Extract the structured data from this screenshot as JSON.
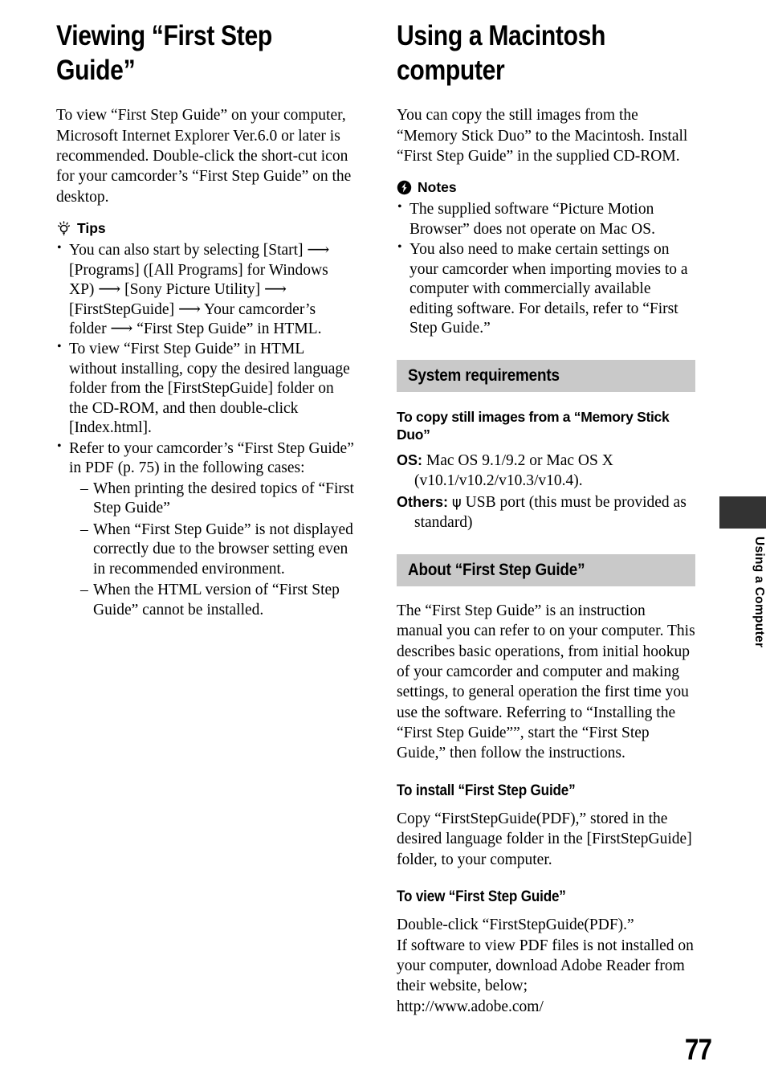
{
  "page": {
    "number": "77",
    "side_tab_label": "Using a Computer",
    "band_color": "#c9c9c9",
    "tab_color": "#333333"
  },
  "left_column": {
    "title": "Viewing “First Step Guide”",
    "intro": "To view “First Step Guide” on your computer, Microsoft Internet Explorer Ver.6.0 or later is recommended. Double-click the short-cut icon for your camcorder’s “First Step Guide” on the desktop.",
    "tips": {
      "icon": "lightbulb-icon",
      "label": "Tips",
      "items": [
        "You can also start by selecting [Start] ⟶ [Programs] ([All Programs] for Windows XP) ⟶ [Sony Picture Utility] ⟶ [FirstStepGuide] ⟶ Your camcorder’s folder ⟶ “First Step Guide” in HTML.",
        "To view “First Step Guide” in HTML without installing, copy the desired language folder from the [FirstStepGuide] folder on the CD-ROM, and then double-click [Index.html].",
        "Refer to your camcorder’s “First Step Guide” in PDF (p. 75) in the following cases:"
      ],
      "sub_items": [
        "When printing the desired topics of “First Step Guide”",
        "When “First Step Guide” is not displayed correctly due to the browser setting even in recommended environment.",
        "When the HTML version of “First Step Guide” cannot be installed."
      ]
    }
  },
  "right_column": {
    "title": "Using a Macintosh computer",
    "intro": "You can copy the still images from the “Memory Stick Duo” to the Macintosh. Install “First Step Guide” in the supplied CD-ROM.",
    "notes": {
      "icon": "warning-bolt-icon",
      "label": "Notes",
      "items": [
        "The supplied software “Picture Motion Browser” does not operate on Mac OS.",
        "You also need to make certain settings on your camcorder when importing movies to a computer with commercially available editing software. For details, refer to “First Step Guide.”"
      ]
    },
    "system_requirements": {
      "band_title": "System requirements",
      "sub_heading": "To copy still images from a “Memory Stick Duo”",
      "rows": [
        {
          "label": "OS:",
          "value": "Mac OS 9.1/9.2 or Mac OS X (v10.1/v10.2/v10.3/v10.4)."
        },
        {
          "label": "Others:",
          "icon": "usb-icon",
          "value": "USB port (this must be provided as standard)"
        }
      ]
    },
    "about_guide": {
      "band_title": "About “First Step Guide”",
      "body": "The “First Step Guide” is an instruction manual you can refer to on your computer. This describes basic operations, from initial hookup of your camcorder and computer and making settings, to general operation the first time you use the software. Referring to “Installing the “First Step Guide””, start the “First Step Guide,” then follow the instructions.",
      "install": {
        "heading": "To install “First Step Guide”",
        "body": "Copy “FirstStepGuide(PDF),” stored in the desired language folder in the [FirstStepGuide] folder, to your computer."
      },
      "view": {
        "heading": "To view “First Step Guide”",
        "body_line1": "Double-click “FirstStepGuide(PDF).”",
        "body_line2": "If software to view PDF files is not installed on your computer, download Adobe Reader from their website, below;",
        "url": "http://www.adobe.com/"
      }
    }
  }
}
